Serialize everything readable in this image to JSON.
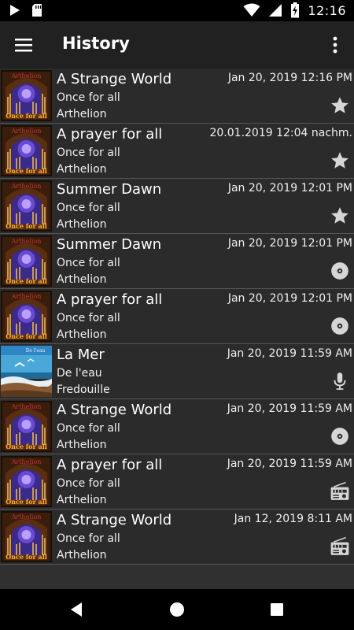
{
  "status_bar": {
    "time": "12:16",
    "left_icons": [
      "play-icon",
      "sd-card-icon"
    ],
    "right_icons": [
      "wifi-icon",
      "signal-icon",
      "battery-charging-icon"
    ]
  },
  "app_bar": {
    "title": "History",
    "menu_icon": "hamburger-menu-icon",
    "overflow_icon": "more-vert-icon"
  },
  "history": [
    {
      "song": "A Strange World",
      "album": "Once for all",
      "artist": "Arthelion",
      "timestamp": "Jan 20, 2019 12:16 PM",
      "source_icon": "star-icon",
      "art": "organ"
    },
    {
      "song": "A prayer for all",
      "album": "Once for all",
      "artist": "Arthelion",
      "timestamp": "20.01.2019 12:04 nachm.",
      "source_icon": "star-icon",
      "art": "organ"
    },
    {
      "song": "Summer Dawn",
      "album": "Once for all",
      "artist": "Arthelion",
      "timestamp": "Jan 20, 2019 12:01 PM",
      "source_icon": "star-icon",
      "art": "organ"
    },
    {
      "song": "Summer Dawn",
      "album": "Once for all",
      "artist": "Arthelion",
      "timestamp": "Jan 20, 2019 12:01 PM",
      "source_icon": "disc-icon",
      "art": "organ"
    },
    {
      "song": "A prayer for all",
      "album": "Once for all",
      "artist": "Arthelion",
      "timestamp": "Jan 20, 2019 12:01 PM",
      "source_icon": "disc-icon",
      "art": "organ"
    },
    {
      "song": "La Mer",
      "album": "De l'eau",
      "artist": "Fredouille",
      "timestamp": "Jan 20, 2019 11:59 AM",
      "source_icon": "microphone-icon",
      "art": "sea"
    },
    {
      "song": "A Strange World",
      "album": "Once for all",
      "artist": "Arthelion",
      "timestamp": "Jan 20, 2019 11:59 AM",
      "source_icon": "disc-icon",
      "art": "organ"
    },
    {
      "song": "A prayer for all",
      "album": "Once for all",
      "artist": "Arthelion",
      "timestamp": "Jan 20, 2019 11:59 AM",
      "source_icon": "radio-icon",
      "art": "organ"
    },
    {
      "song": "A Strange World",
      "album": "Once for all",
      "artist": "Arthelion",
      "timestamp": "Jan 12, 2019 8:11 AM",
      "source_icon": "radio-icon",
      "art": "organ"
    }
  ],
  "album_art_text": {
    "organ_band": "Arthelion",
    "organ_album": "Once for all",
    "sea_caption": "De l'eau"
  },
  "nav_bar": {
    "icons": [
      "back-icon",
      "home-icon",
      "recents-icon"
    ]
  },
  "colors": {
    "status_bar": "#000000",
    "app_bar": "#212121",
    "list_background": "#2b2b2b",
    "divider": "#555555",
    "text": "#ffffff",
    "icon_gray": "#d6d6d6"
  }
}
